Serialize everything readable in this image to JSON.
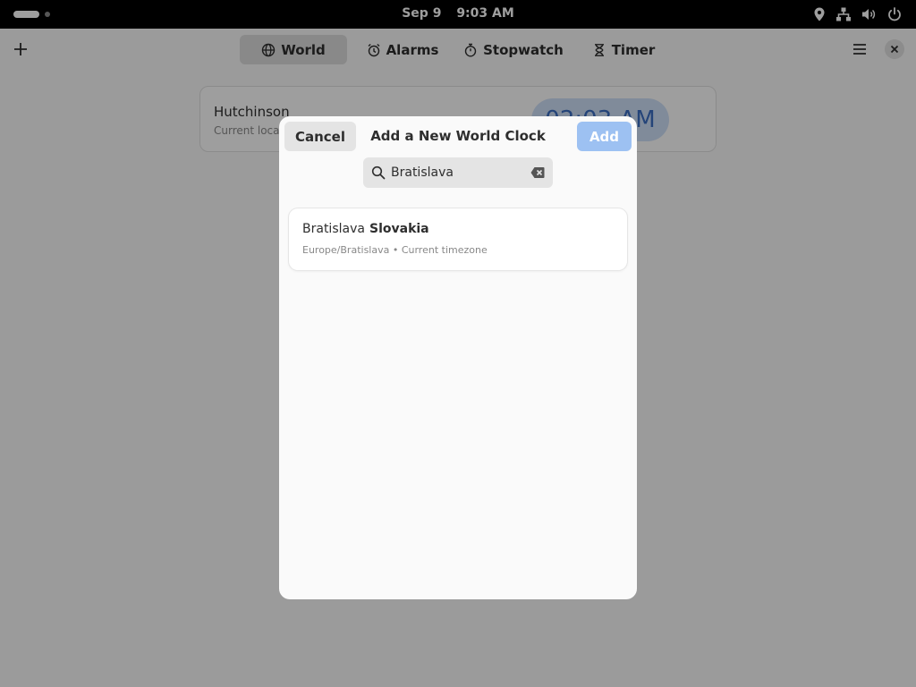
{
  "topbar": {
    "date": "Sep 9",
    "time": "9:03 AM"
  },
  "app": {
    "tabs": [
      {
        "label": "World",
        "icon": "globe-icon",
        "active": true
      },
      {
        "label": "Alarms",
        "icon": "alarm-icon",
        "active": false
      },
      {
        "label": "Stopwatch",
        "icon": "stopwatch-icon",
        "active": false
      },
      {
        "label": "Timer",
        "icon": "hourglass-icon",
        "active": false
      }
    ],
    "world_card": {
      "city": "Hutchinson",
      "subtitle": "Current locati",
      "time": "02:03 AM"
    }
  },
  "dialog": {
    "cancel_label": "Cancel",
    "title": "Add a New World Clock",
    "add_label": "Add",
    "search": {
      "value": "Bratislava"
    },
    "results": [
      {
        "city": "Bratislava",
        "country": "Slovakia",
        "detail": "Europe/Bratislava • Current timezone"
      }
    ]
  },
  "colors": {
    "accent": "#3584e4",
    "add_button_disabled": "#9dc1f2",
    "overlay": "rgba(0,0,0,0.38)"
  }
}
